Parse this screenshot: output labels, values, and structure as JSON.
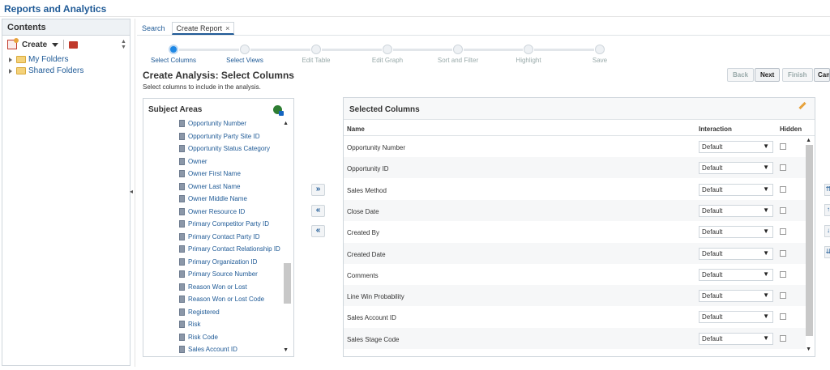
{
  "app_title": "Reports and Analytics",
  "left_pane": {
    "header": "Contents",
    "toolbar": {
      "create_label": "Create"
    },
    "tree": [
      {
        "label": "My Folders"
      },
      {
        "label": "Shared Folders"
      }
    ]
  },
  "tabs": [
    {
      "label": "Search",
      "active": false
    },
    {
      "label": "Create Report",
      "active": true,
      "close": "×"
    }
  ],
  "train": [
    {
      "label": "Select Columns",
      "current": true
    },
    {
      "label": "Select Views",
      "current": false
    },
    {
      "label": "Edit Table",
      "current": false
    },
    {
      "label": "Edit Graph",
      "current": false
    },
    {
      "label": "Sort and Filter",
      "current": false
    },
    {
      "label": "Highlight",
      "current": false
    },
    {
      "label": "Save",
      "current": false
    }
  ],
  "heading": "Create Analysis: Select Columns",
  "subheading": "Select columns to include in the analysis.",
  "buttons": {
    "back": "Back",
    "next": "Next",
    "finish": "Finish",
    "cancel": "Cancel"
  },
  "subject_areas": {
    "title": "Subject Areas",
    "items": [
      "Opportunity Number",
      "Opportunity Party Site ID",
      "Opportunity Status Category",
      "Owner",
      "Owner First Name",
      "Owner Last Name",
      "Owner Middle Name",
      "Owner Resource ID",
      "Primary Competitor Party ID",
      "Primary Contact Party ID",
      "Primary Contact Relationship ID",
      "Primary Organization ID",
      "Primary Source Number",
      "Reason Won or Lost",
      "Reason Won or Lost Code",
      "Registered",
      "Risk",
      "Risk Code",
      "Sales Account ID"
    ]
  },
  "movers": {
    "add": "»",
    "remove": "«",
    "remove_all": "«"
  },
  "selected_columns": {
    "title": "Selected Columns",
    "headers": {
      "name": "Name",
      "interaction": "Interaction",
      "hidden": "Hidden"
    },
    "rows": [
      {
        "name": "Opportunity Number",
        "interaction": "Default"
      },
      {
        "name": "Opportunity ID",
        "interaction": "Default"
      },
      {
        "name": "Sales Method",
        "interaction": "Default"
      },
      {
        "name": "Close Date",
        "interaction": "Default"
      },
      {
        "name": "Created By",
        "interaction": "Default"
      },
      {
        "name": "Created Date",
        "interaction": "Default"
      },
      {
        "name": "Comments",
        "interaction": "Default"
      },
      {
        "name": "Line Win Probability",
        "interaction": "Default"
      },
      {
        "name": "Sales Account ID",
        "interaction": "Default"
      },
      {
        "name": "Sales Stage Code",
        "interaction": "Default"
      }
    ]
  },
  "icons": {
    "create": "create-report-icon",
    "book": "catalog-book-icon",
    "folder": "folder-icon",
    "column": "column-icon",
    "subject_add": "add-subject-area-icon",
    "edit": "pencil-icon"
  }
}
